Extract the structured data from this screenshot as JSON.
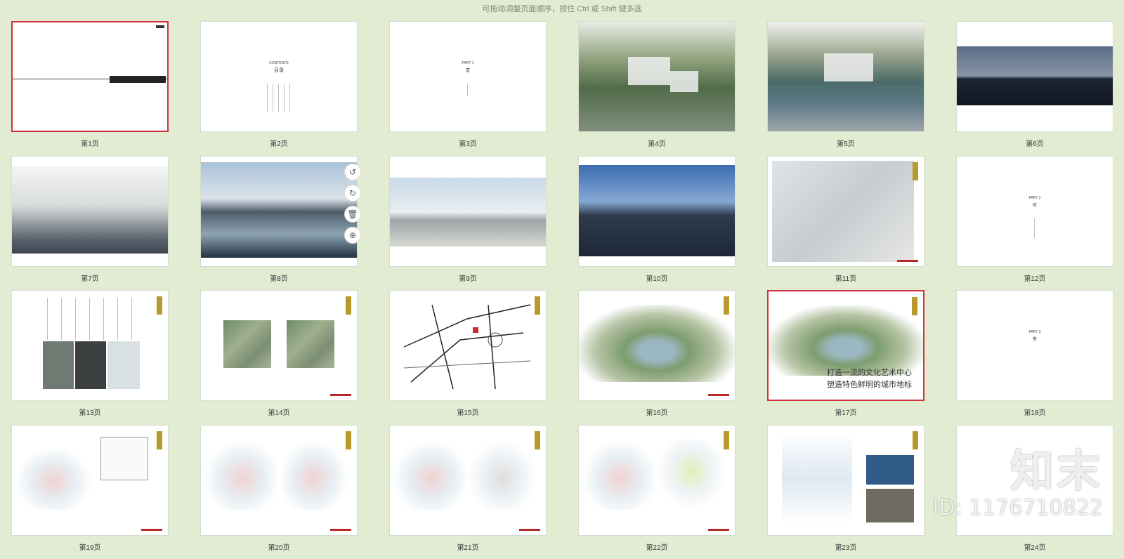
{
  "hint": "可拖动调整页面顺序，按住 Ctrl 或 Shift 键多选",
  "pages": [
    {
      "label": "第1页"
    },
    {
      "label": "第2页"
    },
    {
      "label": "第3页"
    },
    {
      "label": "第4页"
    },
    {
      "label": "第5页"
    },
    {
      "label": "第6页"
    },
    {
      "label": "第7页"
    },
    {
      "label": "第8页"
    },
    {
      "label": "第9页"
    },
    {
      "label": "第10页"
    },
    {
      "label": "第11页"
    },
    {
      "label": "第12页"
    },
    {
      "label": "第13页"
    },
    {
      "label": "第14页"
    },
    {
      "label": "第15页"
    },
    {
      "label": "第16页"
    },
    {
      "label": "第17页"
    },
    {
      "label": "第18页"
    },
    {
      "label": "第19页"
    },
    {
      "label": "第20页"
    },
    {
      "label": "第21页"
    },
    {
      "label": "第22页"
    },
    {
      "label": "第23页"
    },
    {
      "label": "第24页"
    }
  ],
  "thumb_text": {
    "contents": "CONTENTS",
    "mulu": "目录",
    "part1": "PART 1",
    "part1_cn": "壹",
    "part2": "PART 2",
    "part2_cn": "贰",
    "part3": "PART 3",
    "part3_cn": "叁",
    "headline_1": "打造一流的文化艺术中心",
    "headline_2": "塑造特色鲜明的城市地标"
  },
  "tools": [
    "rotate-left-icon",
    "rotate-right-icon",
    "delete-icon",
    "zoom-in-icon"
  ],
  "watermark": {
    "logo": "知末",
    "id": "ID: 1176710822"
  },
  "colors": {
    "background": "#e1ecd3",
    "selected_border": "#d0313c",
    "accent_gold": "#b89a2c"
  }
}
